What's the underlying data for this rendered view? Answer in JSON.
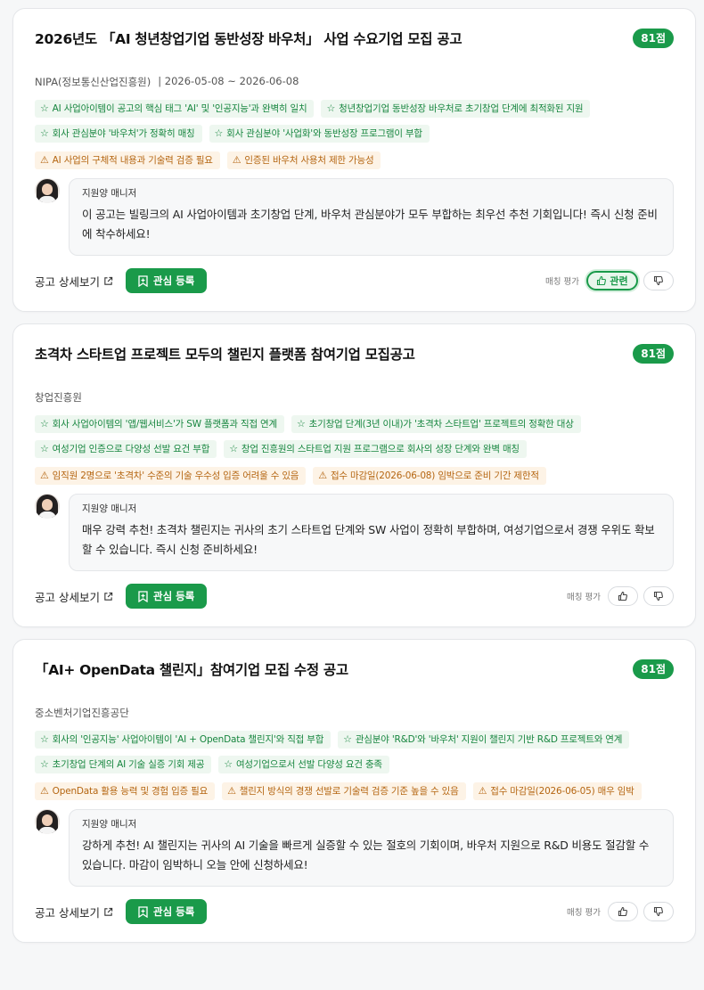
{
  "common": {
    "manager_name": "지원양 매니저",
    "detail_label": "공고 상세보기",
    "favorite_label": "관심 등록",
    "rating_label": "매칭 평가",
    "relevant_label": "관련"
  },
  "cards": [
    {
      "title": "2026년도 「AI 청년창업기업 동반성장 바우처」 사업 수요기업 모집 공고",
      "score": "81점",
      "agency": "NIPA(정보통신산업진흥원)",
      "period": "| 2026-05-08 ~ 2026-06-08",
      "pros": [
        "AI 사업아이템이 공고의 핵심 태그 'AI' 및 '인공지능'과 완벽히 일치",
        "청년창업기업 동반성장 바우처로 초기창업 단계에 최적화된 지원",
        "회사 관심분야 '바우처'가 정확히 매칭",
        "회사 관심분야 '사업화'와 동반성장 프로그램이 부합"
      ],
      "cons": [
        "AI 사업의 구체적 내용과 기술력 검증 필요",
        "인증된 바우처 사용처 제한 가능성"
      ],
      "comment": "이 공고는 빌링크의 AI 사업아이템과 초기창업 단계, 바우처 관심분야가 모두 부합하는 최우선 추천 기회입니다! 즉시 신청 준비에 착수하세요!",
      "voted": true
    },
    {
      "title": "초격차 스타트업 프로젝트 모두의 챌린지 플랫폼 참여기업 모집공고",
      "score": "81점",
      "agency": "창업진흥원",
      "period": "",
      "pros": [
        "회사 사업아이템의 '앱/웹서비스'가 SW 플랫폼과 직접 연계",
        "초기창업 단계(3년 이내)가 '초격차 스타트업' 프로젝트의 정확한 대상",
        "여성기업 인증으로 다양성 선발 요건 부합",
        "창업 진흥원의 스타트업 지원 프로그램으로 회사의 성장 단계와 완벽 매칭"
      ],
      "cons": [
        "임직원 2명으로 '초격차' 수준의 기술 우수성 입증 어려울 수 있음",
        "접수 마감일(2026-06-08) 임박으로 준비 기간 제한적"
      ],
      "comment": "매우 강력 추천! 초격차 챌린지는 귀사의 초기 스타트업 단계와 SW 사업이 정확히 부합하며, 여성기업으로서 경쟁 우위도 확보할 수 있습니다. 즉시 신청 준비하세요!",
      "voted": false
    },
    {
      "title": "「AI+ OpenData 챌린지」참여기업 모집 수정 공고",
      "score": "81점",
      "agency": "중소벤처기업진흥공단",
      "period": "",
      "pros": [
        "회사의 '인공지능' 사업아이템이 'AI + OpenData 챌린지'와 직접 부합",
        "관심분야 'R&D'와 '바우처' 지원이 챌린지 기반 R&D 프로젝트와 연계",
        "초기창업 단계의 AI 기술 실증 기회 제공",
        "여성기업으로서 선발 다양성 요건 충족"
      ],
      "cons": [
        "OpenData 활용 능력 및 경험 입증 필요",
        "챌린지 방식의 경쟁 선발로 기술력 검증 기준 높을 수 있음",
        "접수 마감일(2026-06-05) 매우 임박"
      ],
      "comment": "강하게 추천! AI 챌린지는 귀사의 AI 기술을 빠르게 실증할 수 있는 절호의 기회이며, 바우처 지원으로 R&D 비용도 절감할 수 있습니다. 마감이 임박하니 오늘 안에 신청하세요!",
      "voted": false
    }
  ]
}
